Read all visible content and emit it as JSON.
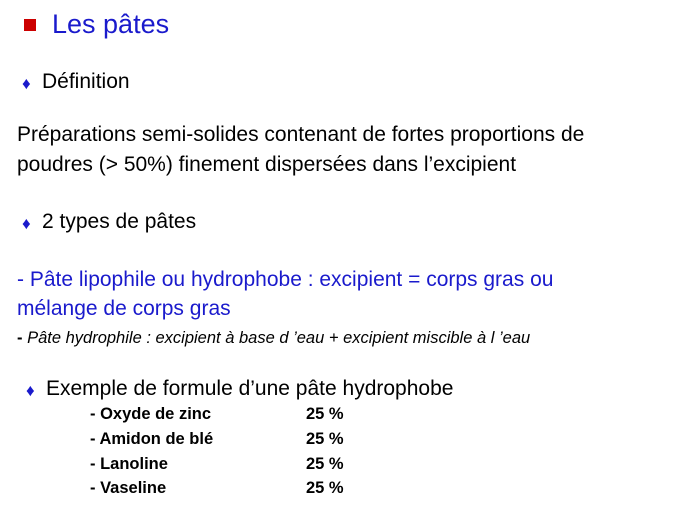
{
  "title": "Les pâtes",
  "colors": {
    "title": "#1a1acc",
    "title_bullet": "#cc0000",
    "diamond": "#1a1acc",
    "lipophile_text": "#1a1acc"
  },
  "icons": {
    "title_bullet": "red-square-icon",
    "section_bullet": "blue-diamond-icon"
  },
  "definition": {
    "heading": "Définition",
    "text_line1": "Préparations semi-solides contenant de fortes proportions de",
    "text_line2": "poudres (> 50%) finement dispersées dans l’excipient"
  },
  "types": {
    "heading": "2 types de pâtes",
    "lipophile_line1": "- Pâte lipophile ou hydrophobe : excipient = corps gras ou",
    "lipophile_line2": "mélange de corps gras",
    "hydrophile_dash": "-",
    "hydrophile_text": " Pâte hydrophile : excipient à base d ’eau + excipient miscible à l ’eau"
  },
  "example": {
    "heading": "Exemple de formule d’une pâte hydrophobe",
    "rows": [
      {
        "name": "- Oxyde de zinc",
        "value": "25 %"
      },
      {
        "name": "- Amidon de blé",
        "value": "25 %"
      },
      {
        "name": "- Lanoline",
        "value": "25 %"
      },
      {
        "name": "- Vaseline",
        "value": "25 %"
      }
    ]
  }
}
